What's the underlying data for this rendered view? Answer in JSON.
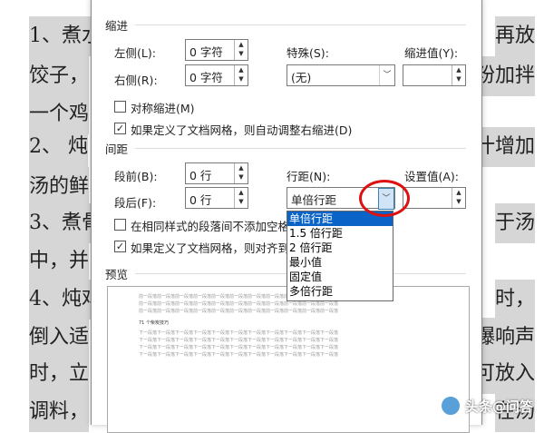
{
  "doc": {
    "left_lines": [
      "1、煮水",
      "饺子，",
      "一个鸡",
      "2、 炖",
      "汤的鲜",
      "3、煮骨",
      "中，并",
      "4、炖鸡",
      "倒入适",
      "时，立",
      "调料，"
    ],
    "right_lines": [
      "再放",
      "粉加拌",
      "",
      "汁增加",
      "",
      "于汤",
      "",
      "时，",
      "爆响声",
      "可放入",
      "在汤"
    ]
  },
  "dialog": {
    "indent_title": "缩进",
    "left_label": "左侧(L):",
    "left_value": "0 字符",
    "right_label": "右侧(R):",
    "right_value": "0 字符",
    "special_label": "特殊(S):",
    "special_value": "(无)",
    "indent_value_label": "缩进值(Y):",
    "mirror_label": "对称缩进(M)",
    "auto_adjust_label": "如果定义了文档网格，则自动调整右缩进(D)",
    "spacing_title": "间距",
    "before_label": "段前(B):",
    "before_value": "0 行",
    "after_label": "段后(F):",
    "after_value": "0 行",
    "line_spacing_label": "行距(N):",
    "line_spacing_value": "单倍行距",
    "setting_label": "设置值(A):",
    "no_space_label": "在相同样式的段落间不添加空格(C)",
    "snap_grid_label": "如果定义了文档网格，则对齐到网",
    "preview_title": "预览",
    "dropdown_options": [
      "单倍行距",
      "1.5 倍行距",
      "2 倍行距",
      "最小值",
      "固定值",
      "多倍行距"
    ],
    "preview_prev_text": "前一段落前一段落前一段落前一段落前一段落前一段落前一段落前一段落前一段落前一段落前一段落",
    "preview_sample": "71 个柴炭技巧",
    "preview_next_text": "下一段落下一段落下一段落下一段落下一段落下一段落下一段落下一段落下一段落下一段落下一段落"
  },
  "watermark": "头条@问答"
}
